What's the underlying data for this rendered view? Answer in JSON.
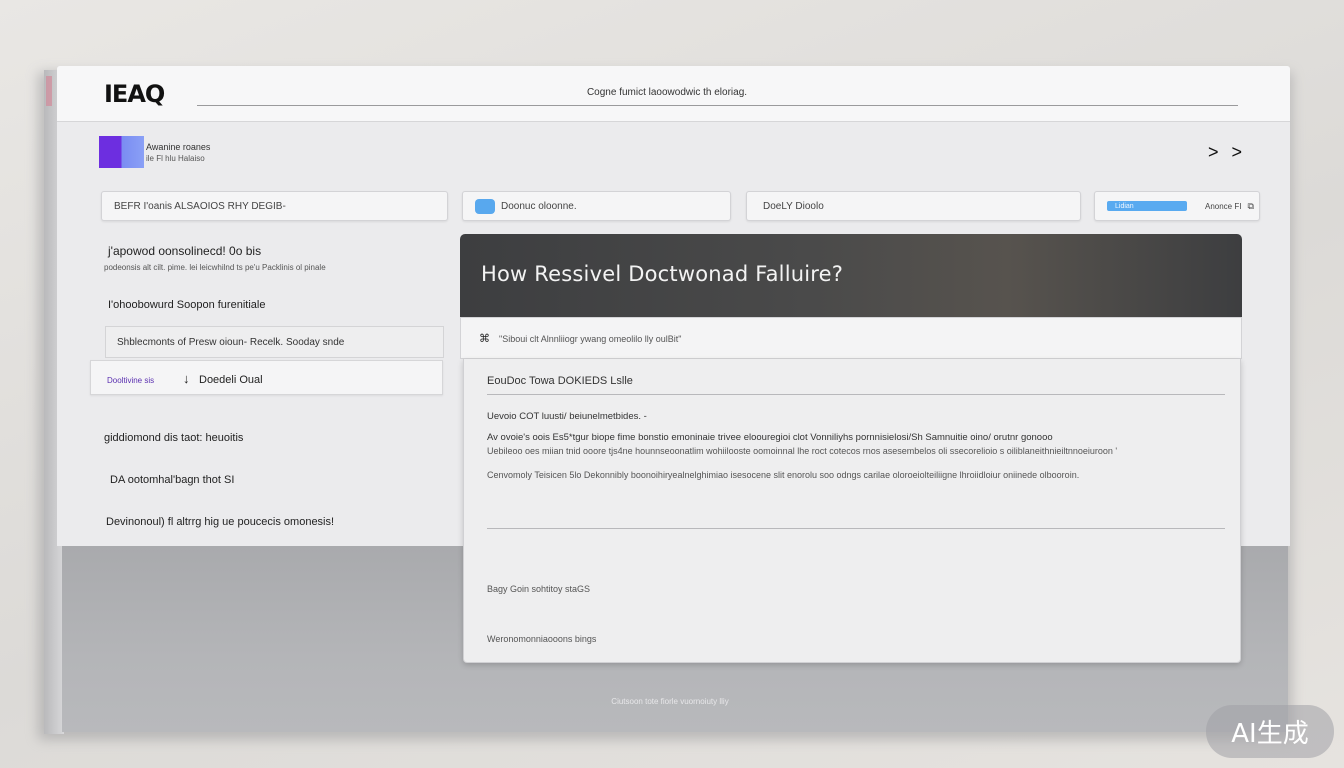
{
  "header": {
    "logo": "IEAQ",
    "tagline": "Cogne fumict laoowodwic th eloriag."
  },
  "brand": {
    "name": "Awanine roanes",
    "sub": "ile Fl hlu Halaiso"
  },
  "nav": {
    "arrows": "> >"
  },
  "filters": [
    {
      "label": "BEFR I'oanis ALSAOIOS RHY DEGIB-"
    },
    {
      "label": "Doonuc oloonne."
    },
    {
      "label": "DoeLY Dioolo"
    },
    {
      "bar_label": "Lidian",
      "label": "Anonce FI"
    }
  ],
  "sidebar": {
    "heading": "j'apowod oonsolinecd! 0o bis",
    "subheading": "podeonsis alt cilt. pime. lei leicwhilnd ts pe'u Packlinis ol pinale",
    "item_plain": "I'ohoobowurd Soopon furenitiale",
    "item_boxed": "Shblecmonts of Presw oioun- Recelk. Sooday snde",
    "active": {
      "badge": "Dooltivine sis",
      "arrow": "↓",
      "label": "Doedeli Oual"
    },
    "links": [
      "giddiomond dis taot: heuoitis",
      "DA ootomhal'bagn thot  SI",
      "Devinonoul) fl altrrg hig ue poucecis omonesis!"
    ]
  },
  "article": {
    "title": "How Ressivel Doctwonad Falluire?",
    "meta_glyph": "⌘",
    "meta_text": "\"Siboui clt Alnnliiogr ywang omeolilo lly oulBit\"",
    "section_title": "EouDoc Towa DOKIEDS Lslle",
    "line1": "Uevoio COT luusti/ beiunelmetbides. -",
    "line2": "Av ovoie's oois Es5*tgur biope fime bonstio emoninaie trivee eloouregioi clot Vonniliyhs pornnisielosi/Sh Samnuitie oino/ orutnr gonooo",
    "line3": "Uebileoo oes miian tnid ooore tjs4ne hounnseoonatlim wohiilooste oomoinnal lhe roct cotecos rnos asesembelos oli ssecorelioio s oiliblaneithnieiltnnoeiuroon '",
    "line4": "Cenvomoly Teisicen 5lo Dekonnibly boonoihiryealnelghimiao isesocene slit enorolu soo odngs carilae oloroeiolteiliigne lhroiidloiur oniinede olbooroin.",
    "footer_label1": "Bagy Goin sohtitoy staGS",
    "footer_label2": "Weronomonniaooons bings"
  },
  "page_footer": "Ciutsoon tote fiorle vuornoiuty lliy",
  "watermark": "AI生成"
}
